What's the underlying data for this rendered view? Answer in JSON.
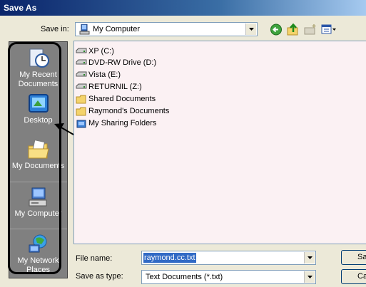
{
  "window": {
    "title": "Save As"
  },
  "savein": {
    "label": "Save in:",
    "value": "My Computer"
  },
  "toolbar": {
    "back_icon": "back-arrow-icon",
    "up_icon": "up-folder-icon",
    "newfolder_icon": "new-folder-icon",
    "views_icon": "views-menu-icon"
  },
  "places": [
    {
      "label": "My Recent Documents",
      "icon": "recent-documents-icon"
    },
    {
      "label": "Desktop",
      "icon": "desktop-icon"
    },
    {
      "label": "My Documents",
      "icon": "my-documents-icon"
    },
    {
      "label": "My Computer",
      "icon": "my-computer-icon"
    },
    {
      "label": "My Network Places",
      "icon": "network-places-icon"
    }
  ],
  "files": [
    {
      "name": "XP (C:)",
      "icon": "drive-icon"
    },
    {
      "name": "DVD-RW Drive (D:)",
      "icon": "drive-icon"
    },
    {
      "name": "Vista (E:)",
      "icon": "drive-icon"
    },
    {
      "name": "RETURNIL (Z:)",
      "icon": "drive-icon"
    },
    {
      "name": "Shared Documents",
      "icon": "folder-icon"
    },
    {
      "name": "Raymond's Documents",
      "icon": "folder-icon"
    },
    {
      "name": "My Sharing Folders",
      "icon": "sharing-folder-icon"
    }
  ],
  "filename": {
    "label": "File name:",
    "value": "raymond.cc.txt"
  },
  "filetype": {
    "label": "Save as type:",
    "value": "Text Documents (*.txt)"
  },
  "buttons": {
    "save": "Sa",
    "cancel": "Ca"
  },
  "colors": {
    "title_start": "#0a246a",
    "places_bg": "#808080",
    "selection": "#316ac5"
  }
}
